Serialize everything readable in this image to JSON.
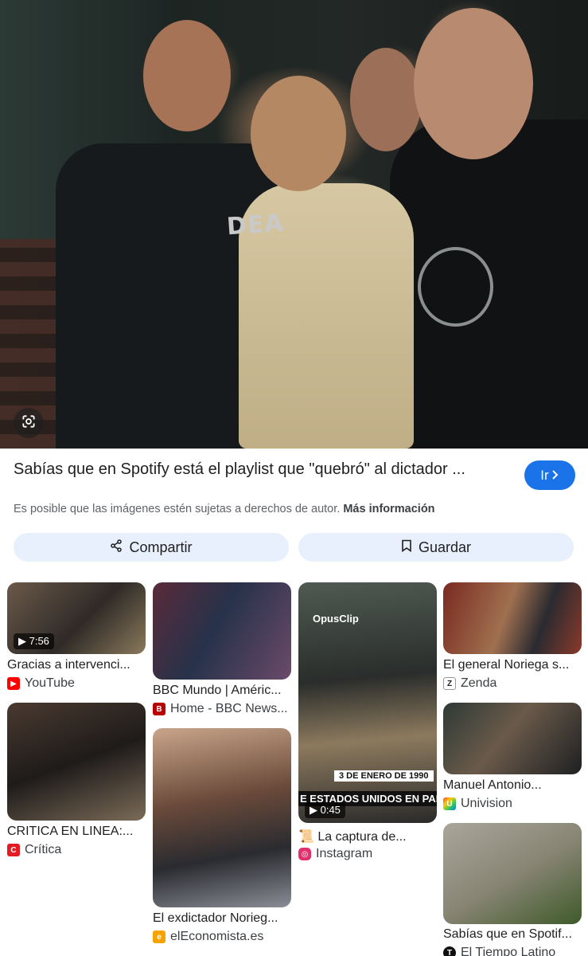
{
  "result": {
    "title": "Sabías que en Spotify está el playlist que \"quebró\" al dictador ...",
    "visit_label": "Ir",
    "copyright_notice": "Es posible que las imágenes estén sujetas a derechos de autor.",
    "more_info_label": "Más información",
    "share_label": "Compartir",
    "save_label": "Guardar"
  },
  "hero": {
    "overlay_text": "DEA"
  },
  "related": [
    {
      "title": "Gracias a intervenci...",
      "source": "YouTube",
      "duration": "7:56",
      "favicon_color": "#ff0000"
    },
    {
      "title": "BBC Mundo | Améric...",
      "source": "Home - BBC News...",
      "favicon_color": "#b80000"
    },
    {
      "title": "La captura de...",
      "source": "Instagram",
      "duration": "0:45",
      "brand": "OpusClip",
      "caption_date": "3 DE ENERO DE 1990",
      "caption_line": "E ESTADOS UNIDOS EN PANAM",
      "favicon_color": "#e1306c"
    },
    {
      "title": "El general Noriega s...",
      "source": "Zenda",
      "favicon_color": "#222222"
    },
    {
      "title": "CRITICA EN LINEA:...",
      "source": "Crítica",
      "favicon_color": "#e31b23"
    },
    {
      "title": "El exdictador Norieg...",
      "source": "elEconomista.es",
      "favicon_color": "#f4a300"
    },
    {
      "title": "Manuel Antonio...",
      "source": "Univision",
      "favicon_color": "#7b2cbf"
    },
    {
      "title": "Sabías que en Spotif...",
      "source": "El Tiempo Latino",
      "favicon_color": "#111111"
    }
  ]
}
